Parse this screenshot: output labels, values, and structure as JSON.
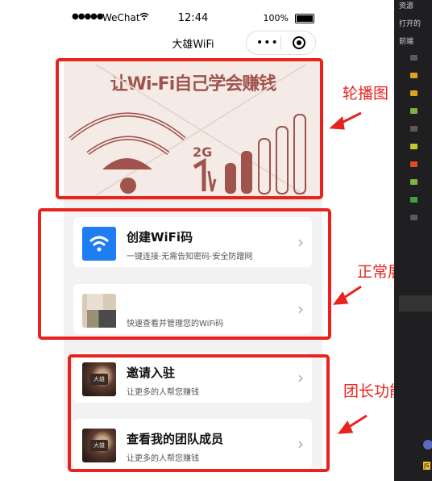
{
  "status_bar": {
    "signal": "●●●●●",
    "carrier": "WeChat",
    "time": "12:44",
    "battery": "100%"
  },
  "nav": {
    "title": "大雄WiFi"
  },
  "banner": {
    "title": "让Wi-Fi自己学会赚钱",
    "badge": "2G"
  },
  "cards": [
    {
      "title": "创建WiFi码",
      "subtitle": "一键连接·无需告知密码·安全防蹭网",
      "icon": "wifi-icon"
    },
    {
      "title": "",
      "subtitle": "快速查看并管理您的WiFi码",
      "icon": "blurred-thumbnail"
    },
    {
      "title": "邀请入驻",
      "subtitle": "让更多的人帮您赚钱",
      "icon": "logo-thumbnail"
    },
    {
      "title": "查看我的团队成员",
      "subtitle": "让更多的人帮您赚钱",
      "icon": "logo-thumbnail"
    }
  ],
  "logo_text": "大雄",
  "annotations": {
    "carousel": "轮播图",
    "normal": "正常展示",
    "leader": "团长功能"
  },
  "ide": {
    "top": "资源",
    "open": "打开的",
    "section": "前端",
    "file_badge": "JS"
  },
  "colors": {
    "annotation_red": "#e8231d",
    "banner_bg": "#f5ebe6",
    "banner_brown": "#a0524c",
    "wifi_blue": "#1e7df0"
  }
}
